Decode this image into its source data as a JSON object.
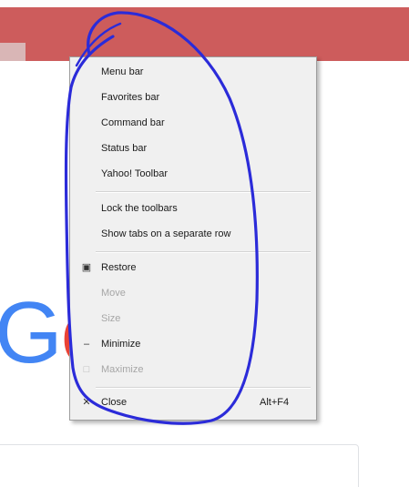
{
  "context_menu": {
    "items": [
      {
        "label": "Menu bar",
        "disabled": false
      },
      {
        "label": "Favorites bar",
        "disabled": false
      },
      {
        "label": "Command bar",
        "disabled": false
      },
      {
        "label": "Status bar",
        "disabled": false
      },
      {
        "label": "Yahoo! Toolbar",
        "disabled": false
      },
      {
        "label": "Lock the toolbars",
        "disabled": false
      },
      {
        "label": "Show tabs on a separate row",
        "disabled": false
      },
      {
        "label": "Restore",
        "disabled": false,
        "icon": "restore-icon"
      },
      {
        "label": "Move",
        "disabled": true
      },
      {
        "label": "Size",
        "disabled": true
      },
      {
        "label": "Minimize",
        "disabled": false,
        "icon": "minimize-icon"
      },
      {
        "label": "Maximize",
        "disabled": true,
        "icon": "maximize-icon"
      },
      {
        "label": "Close",
        "disabled": false,
        "shortcut": "Alt+F4",
        "icon": "close-icon"
      }
    ]
  },
  "logo": {
    "letter_g": "G",
    "letter_o": "o"
  },
  "colors": {
    "title_strip": "#cd5c5c",
    "menu_background": "#f0f0f0",
    "annotation_stroke": "#2b2bd9",
    "disabled_text": "#a6a6a6",
    "logo_blue": "#4285f4",
    "logo_red": "#ea4335"
  }
}
